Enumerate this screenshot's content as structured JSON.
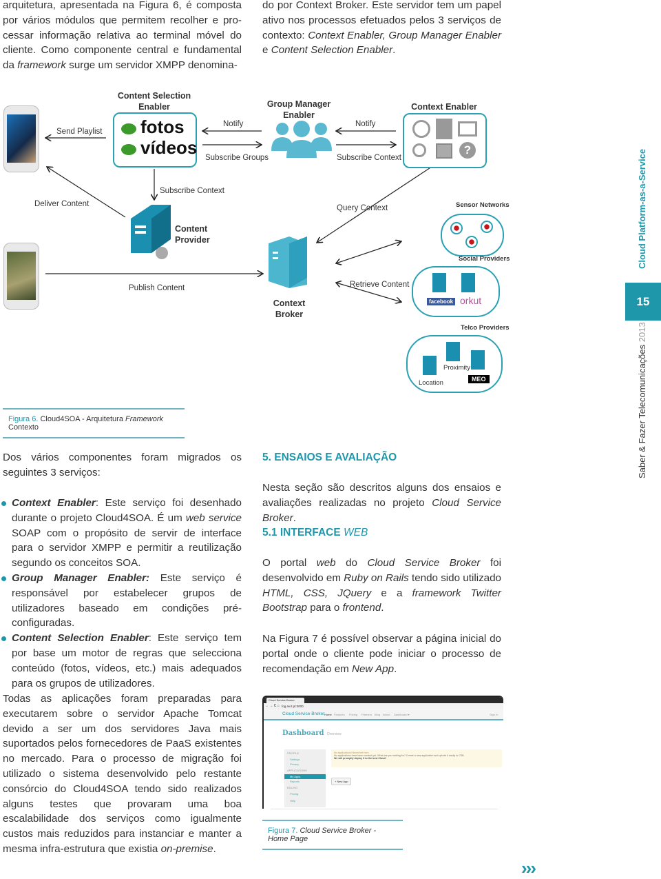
{
  "top_left_para": [
    "arquitetura, apresentada na Figura 6, é composta",
    "por vários módulos que permitem recolher e pro-",
    "cessar informação relativa ao terminal móvel do",
    "cliente. Como componente central e fundamental",
    "da ",
    "framework",
    " surge um servidor XMPP denomina-"
  ],
  "top_right_para": {
    "line1": "do por Context Broker. Este servidor tem um papel",
    "line2": "ativo nos processos efetuados pelos 3 serviços de",
    "line3_a": "contexto: ",
    "line3_b": "Context Enabler, Group Manager Enabler",
    "line3_c": " e",
    "line4": "Content Selection Enabler",
    "line4_end": "."
  },
  "diagram": {
    "content_selection_title": "Content Selection Enabler",
    "fotos": "fotos",
    "videos": "vídeos",
    "group_manager_title": "Group Manager Enabler",
    "context_enabler_title": "Context Enabler",
    "send_playlist": "Send Playlist",
    "notify_1": "Notify",
    "subscribe_groups": "Subscribe Groups",
    "notify_2": "Notify",
    "subscribe_context_top": "Subscribe Context",
    "deliver_content": "Deliver Content",
    "subscribe_context_mid": "Subscribe Context",
    "content_provider": "Content Provider",
    "query_context": "Query Context",
    "sensor_networks": "Sensor Networks",
    "social_providers": "Social Providers",
    "publish_content": "Publish Content",
    "context_broker": "Context Broker",
    "retrieve_content": "Retrieve Content",
    "facebook": "facebook",
    "orkut": "orkut",
    "telco_providers": "Telco Providers",
    "proximity": "Proximity",
    "location": "Location",
    "meo": "MEO",
    "context_icons": [
      "compass-icon",
      "upload-document-icon",
      "world-map-icon",
      "search-icon",
      "photos-icon",
      "help-icon"
    ]
  },
  "figure6_caption": {
    "label": "Figura 6.",
    "text_a": " Cloud4SOA - Arquitetura ",
    "text_b": "Framework",
    "text_c": " Contexto"
  },
  "intro_services": "Dos vários componentes foram migrados os seguintes 3 serviços:",
  "bullets": [
    {
      "term": "Context Enabler",
      "sep": ": ",
      "text_a": "Este serviço foi desenhado durante o projeto Cloud4SOA. É um ",
      "text_b": "web service",
      "text_c": " SOAP com o propósito de servir de interface para o servidor XMPP e permitir a reutilização segundo os conceitos SOA."
    },
    {
      "term": "Group Manager Enabler:",
      "sep": " ",
      "text_a": "Este serviço é responsável por estabelecer grupos de utilizadores baseado em condições pré-configuradas.",
      "text_b": "",
      "text_c": ""
    },
    {
      "term": "Content Selection Enabler",
      "sep": ": ",
      "text_a": "Este serviço tem por base um motor de regras que selecciona conteúdo (fotos, vídeos, etc.) mais adequados para os grupos de utilizadores.",
      "text_b": "",
      "text_c": ""
    }
  ],
  "bottom_left_para_a": "Todas as aplicações foram preparadas para executarem sobre o servidor Apache Tomcat devido a ser um dos servidores Java mais suportados pelos fornecedores de PaaS existentes no mercado. Para o processo de migração foi utilizado o sistema desenvolvido pelo restante consórcio do Cloud4SOA tendo sido realizados alguns testes que provaram uma boa escalabilidade dos serviços como igualmente custos mais reduzidos para instanciar e manter a mesma infra-estrutura que existia ",
  "bottom_left_para_b": "on-premise",
  "bottom_left_para_c": ".",
  "section5": {
    "title": "5. ENSAIOS E AVALIAÇÃO",
    "para_a": "Nesta seção são descritos alguns dos ensaios e avaliações realizadas no projeto ",
    "para_b": "Cloud Service Broker",
    "para_c": "."
  },
  "section51": {
    "title_a": "5.1 INTERFACE ",
    "title_b": "WEB"
  },
  "portal_para": {
    "a": "O portal ",
    "b": "web",
    "c": " do ",
    "d": "Cloud Service Broker",
    "e": " foi desenvolvido em ",
    "f": "Ruby on Rails",
    "g": " tendo sido utilizado ",
    "h": "HTML, CSS, JQuery",
    "i": " e a ",
    "j": "framework Twitter Bootstrap",
    "k": " para o ",
    "l": "frontend",
    "m": "."
  },
  "figura7_para": {
    "a": "Na Figura 7 é possível observar a página inicial do portal onde o cliente pode iniciar o processo de recomendação em ",
    "b": "New App",
    "c": "."
  },
  "screenshot": {
    "tab_title": "Cloud Service Broker",
    "url": "fog.av.it.pt:3000",
    "brand": "Cloud Service Broker",
    "nav": [
      "Home",
      "Features",
      "Pricing",
      "Partners",
      "Blog",
      "About",
      "Dashboard ▾"
    ],
    "signin": "Sign In",
    "heading": "Dashboard",
    "heading_sub": "Overview",
    "side_sections": [
      {
        "header": "PROFILE",
        "items": [
          "Settings",
          "Privacy"
        ]
      },
      {
        "header": "APPLICATIONS",
        "items": [
          "My Apps",
          "Reports"
        ]
      },
      {
        "header": "BILLING",
        "items": [
          "Pricing"
        ]
      },
      {
        "header": "",
        "items": [
          "Help"
        ]
      }
    ],
    "alert_title": "No applications! Never fret here.",
    "alert_text": "No applications have been created yet. What are you waiting for? Create a new application and upload it easily to CSB.",
    "alert_bold": "We will promptly deploy it to the best Cloud!",
    "new_app": "+ New App"
  },
  "figure7_caption": {
    "label": "Figura 7.",
    "text": " Cloud Service Broker - Home Page"
  },
  "sidebar": {
    "section": "Cloud Platform-as-a-Service",
    "page_number": "15",
    "publication_a": "Saber & Fazer Telecomunicações",
    "publication_b": " 2013"
  },
  "next_page": "›››",
  "colors": {
    "accent": "#1f97ab",
    "border": "#6fb5c1"
  }
}
